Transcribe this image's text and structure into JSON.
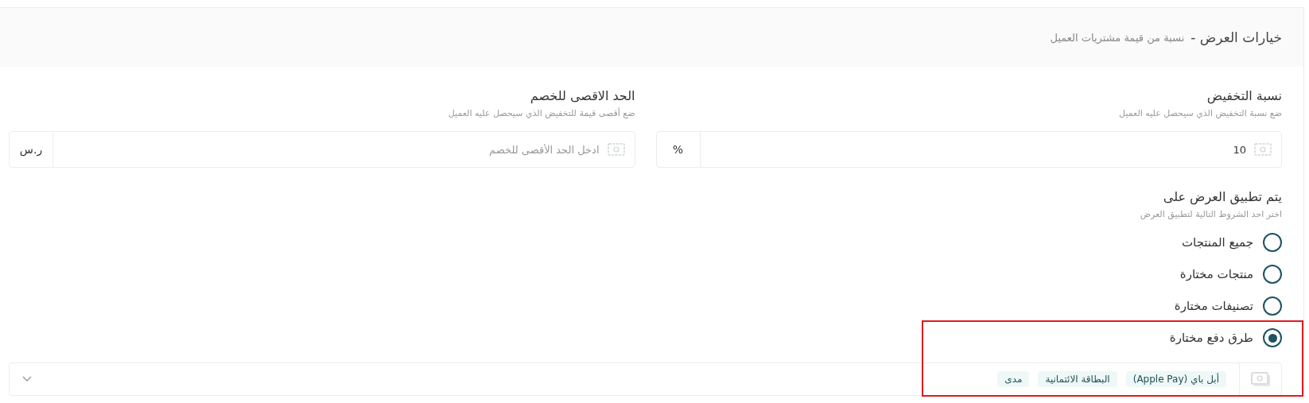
{
  "header": {
    "title": "خيارات العرض -",
    "subtitle": "نسبة من قيمة مشتريات العميل"
  },
  "fields": [
    {
      "label": "نسبة التخفيض",
      "hint": "ضع نسبة التخفيض الذي سيحصل عليه العميل",
      "value": "10",
      "unit": "%"
    },
    {
      "label": "الحد الاقصى للخصم",
      "hint": "ضع أقصى قيمة للتخفيض الذي سيحصل عليه العميل",
      "placeholder": "ادخل الحد الأقصى للخصم",
      "unit": "ر.س"
    }
  ],
  "apply": {
    "title": "يتم تطبيق العرض على",
    "hint": "اختر احد الشروط التالية لتطبيق العرض",
    "options": [
      {
        "label": "جميع المنتجات",
        "selected": false,
        "highlighted": false
      },
      {
        "label": "منتجات مختارة",
        "selected": false,
        "highlighted": false
      },
      {
        "label": "تصنيفات مختارة",
        "selected": false,
        "highlighted": false
      },
      {
        "label": "طرق دفع مختارة",
        "selected": true,
        "highlighted": true
      }
    ]
  },
  "payment_methods": {
    "tags": [
      "أبل باي (Apple Pay)",
      "البطاقة الائتمانية",
      "مدى"
    ]
  }
}
